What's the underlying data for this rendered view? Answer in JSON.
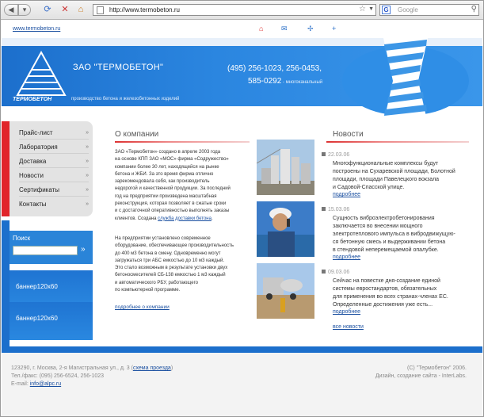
{
  "browser": {
    "url": "http://www.termobeton.ru",
    "search_placeholder": "Google"
  },
  "site": {
    "top_link": "www.termobeton.ru",
    "logo_text": "ТЕРМОБЕТОН",
    "company_name": "ЗАО \"ТЕРМОБЕТОН\"",
    "company_sub": "производство бетона и железобетонных изделий",
    "phone_line1": "(495) 256-1023, 256-0453,",
    "phone_line2": "585-0292",
    "phone_note": " - многоканальный"
  },
  "menu": {
    "items": [
      {
        "label": "Прайс-лист"
      },
      {
        "label": "Лаборатория"
      },
      {
        "label": "Доставка"
      },
      {
        "label": "Новости"
      },
      {
        "label": "Сертификаты"
      },
      {
        "label": "Контакты"
      }
    ],
    "arrow": "»"
  },
  "search": {
    "label": "Поиск",
    "go": "»"
  },
  "banners": [
    "баннер120x60",
    "баннер120x60"
  ],
  "about": {
    "title": "О компании",
    "p1_lines": [
      "ЗАО «Термобетон» создано в апреле 2003 года",
      "на основе КПП ЗАО «МОС» фирма «Содружество»",
      "компании более 30 лет, находящейся на рынке",
      "бетона и ЖБИ. За это время фирма отлично",
      "зарекомендовала себя, как производитель",
      "недорогой и качественной продукции. За последний",
      "год на предприятии произведена масштабная",
      "реконструкция, которая позволяет в сжатые сроки",
      "и с достаточной оперативностью выполнять заказы"
    ],
    "p1_last_prefix": "клиентов. Создана ",
    "p1_link": "служба доставки бетона",
    "p1_last_suffix": ".",
    "p2_lines": [
      "На предприятии установлено современное",
      "оборудование, обеспечивающее производительность",
      "до 400 м3 бетона в смену. Одновременно могут",
      "загружаться три АБС емкостью до 10 м3 каждый.",
      "Это стало возможным в результате установки двух",
      "бетоносмесителей СБ-138 емкостью 1 м3 каждый",
      "и автоматического РБУ, работающего",
      "по компьютерной программе."
    ],
    "more": "подробнее о компании"
  },
  "news": {
    "title": "Новости",
    "items": [
      {
        "date": "22.03.06",
        "lines": [
          "Многофункциональные комплексы будут",
          "построены на Сухаревской площади, Болотной",
          "площади, площади Павелецкого вокзала",
          "и Садовой-Спасской улице."
        ],
        "more": "подробнее"
      },
      {
        "date": "15.03.06",
        "lines": [
          "Сущность виброэлектробетонирования",
          "заключается во внесении мощного",
          "электротеплового импульса в вибродвижущую-",
          "ся бетонную смесь и выдерживании бетона",
          "в стендовой неперемещаемой опалубке."
        ],
        "more": "подробнее"
      },
      {
        "date": "09.03.06",
        "lines": [
          "Сейчас на повестке дня-создание единой",
          "системы евростандартов,  обязательных",
          "для применения во всех странах-членах ЕС.",
          "Определенные достижения уже есть..."
        ],
        "more": "подробнее"
      }
    ],
    "all": "все новости"
  },
  "footer": {
    "addr_prefix": "123290, г. Москва, 2-я Магистральная ул., д. 3 (",
    "addr_link": "схема проезда",
    "addr_suffix": ")",
    "phone": "Тел./факс: (095) 256-6524, 256-1023",
    "email_label": "E-mail: ",
    "email": "info@alpc.ru",
    "copyright": "(С) \"Термобетон\" 2006.",
    "design": "Дизайн, создание сайта - InterLabs."
  }
}
